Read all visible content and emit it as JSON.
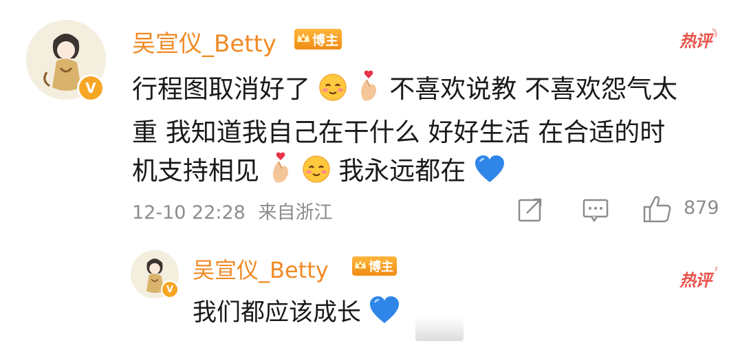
{
  "comment": {
    "username": "吴宣仪_Betty",
    "badge_label": "博主",
    "hot_label": "热评",
    "lines": [
      [
        "行程图取消好了",
        "smile-face-emoji",
        "heart-fingers-emoji",
        "不喜欢说教 不喜欢怨气太"
      ],
      [
        "重 我知道我自己在干什么 好好生活 在合适的时"
      ],
      [
        "机支持相见",
        "heart-fingers-emoji",
        "smile-face-emoji",
        "我永远都在",
        "blue-heart-emoji"
      ]
    ],
    "line1_a": "行程图取消好了",
    "line1_b": "不喜欢说教 不喜欢怨气太",
    "line2": "重 我知道我自己在干什么 好好生活 在合适的时",
    "line3_a": "机支持相见",
    "line3_b": "我永远都在",
    "timestamp": "12-10 22:28",
    "source": "来自浙江",
    "like_count": "879",
    "icons": [
      "share-icon",
      "comment-icon",
      "like-icon"
    ]
  },
  "reply": {
    "username": "吴宣仪_Betty",
    "badge_label": "博主",
    "hot_label": "热评",
    "text": "我们都应该成长"
  },
  "colors": {
    "username": "#f08a24",
    "badge": "#f6a623",
    "hot": "#e8524a",
    "meta": "#8c8c8c",
    "blue_heart": "#2f86e8"
  }
}
